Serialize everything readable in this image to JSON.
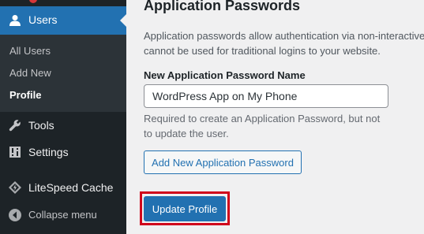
{
  "sidebar": {
    "active_menu": {
      "label": "Users",
      "icon": "user-icon"
    },
    "submenu": [
      {
        "label": "All Users",
        "current": false
      },
      {
        "label": "Add New",
        "current": false
      },
      {
        "label": "Profile",
        "current": true
      }
    ],
    "items": [
      {
        "label": "Tools",
        "icon": "wrench-icon"
      },
      {
        "label": "Settings",
        "icon": "settings-icon"
      },
      {
        "label": "LiteSpeed Cache",
        "icon": "litespeed-icon"
      },
      {
        "label": "Collapse menu",
        "icon": "collapse-icon"
      }
    ],
    "colors": {
      "background": "#1d2327",
      "submenu": "#2c3338",
      "active": "#2271b1",
      "notification": "#d63638"
    }
  },
  "main": {
    "section_title": "Application Passwords",
    "description_line1": "Application passwords allow authentication via non-interactive",
    "description_line2": "cannot be used for traditional logins to your website.",
    "field_label": "New Application Password Name",
    "field_value": "WordPress App on My Phone",
    "help_line1": "Required to create an Application Password, but not",
    "help_line2": "to update the user.",
    "add_button": "Add New Application Password",
    "update_button": "Update Profile",
    "highlight_color": "#d0021b"
  }
}
